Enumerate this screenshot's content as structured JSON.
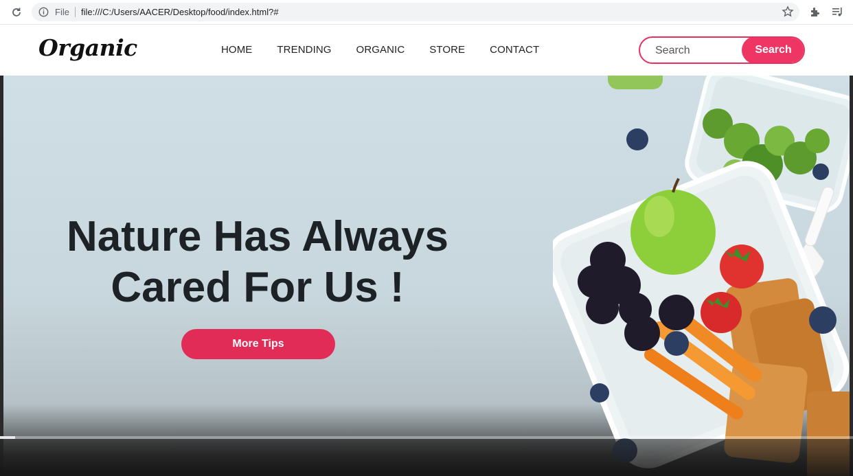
{
  "browser": {
    "file_label": "File",
    "url": "file:///C:/Users/AACER/Desktop/food/index.html?#"
  },
  "site": {
    "logo": "Organic",
    "nav": [
      "HOME",
      "TRENDING",
      "ORGANIC",
      "STORE",
      "CONTACT"
    ],
    "search": {
      "placeholder": "Search",
      "button": "Search"
    }
  },
  "hero": {
    "headline_line1": "Nature Has Always",
    "headline_line2": "Cared For Us !",
    "cta": "More Tips"
  },
  "colors": {
    "accent": "#ee3564",
    "cta": "#e12c57",
    "hero_bg": "#cfdfe5",
    "headline": "#1c2225"
  },
  "video": {
    "progress_fraction": 0.018
  }
}
